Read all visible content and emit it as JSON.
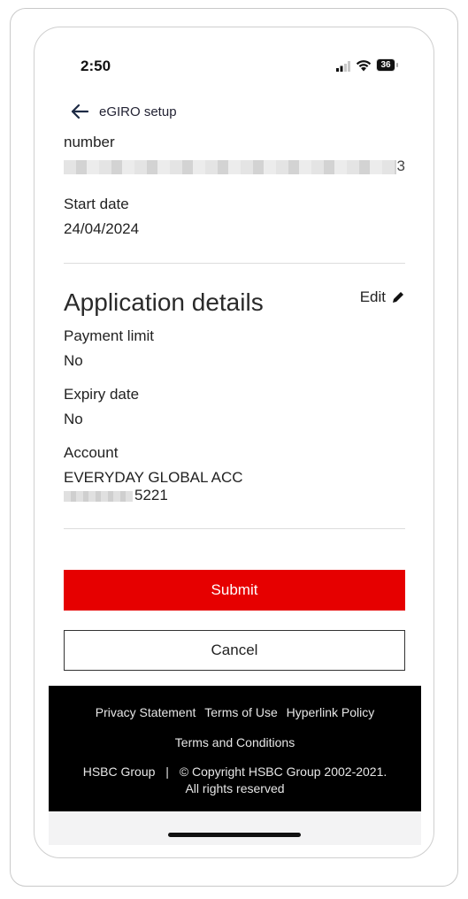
{
  "status_bar": {
    "time": "2:50",
    "battery": "36"
  },
  "header": {
    "title": "eGIRO setup"
  },
  "top_fields": {
    "partial_label": "number",
    "masked_tail": "3",
    "start_date_label": "Start date",
    "start_date_value": "24/04/2024"
  },
  "application_details": {
    "title": "Application details",
    "edit_label": "Edit",
    "payment_limit_label": "Payment limit",
    "payment_limit_value": "No",
    "expiry_date_label": "Expiry date",
    "expiry_date_value": "No",
    "account_label": "Account",
    "account_name": "EVERYDAY GLOBAL ACC",
    "account_number_suffix": "5221"
  },
  "actions": {
    "submit_label": "Submit",
    "cancel_label": "Cancel"
  },
  "footer": {
    "links": [
      "Privacy Statement",
      "Terms of Use",
      "Hyperlink Policy"
    ],
    "terms_label": "Terms and Conditions",
    "group_label": "HSBC Group",
    "separator": "|",
    "copyright": "© Copyright HSBC Group 2002-2021.",
    "rights": "All rights reserved"
  },
  "colors": {
    "accent": "#e60000",
    "footer_bg": "#000000"
  }
}
